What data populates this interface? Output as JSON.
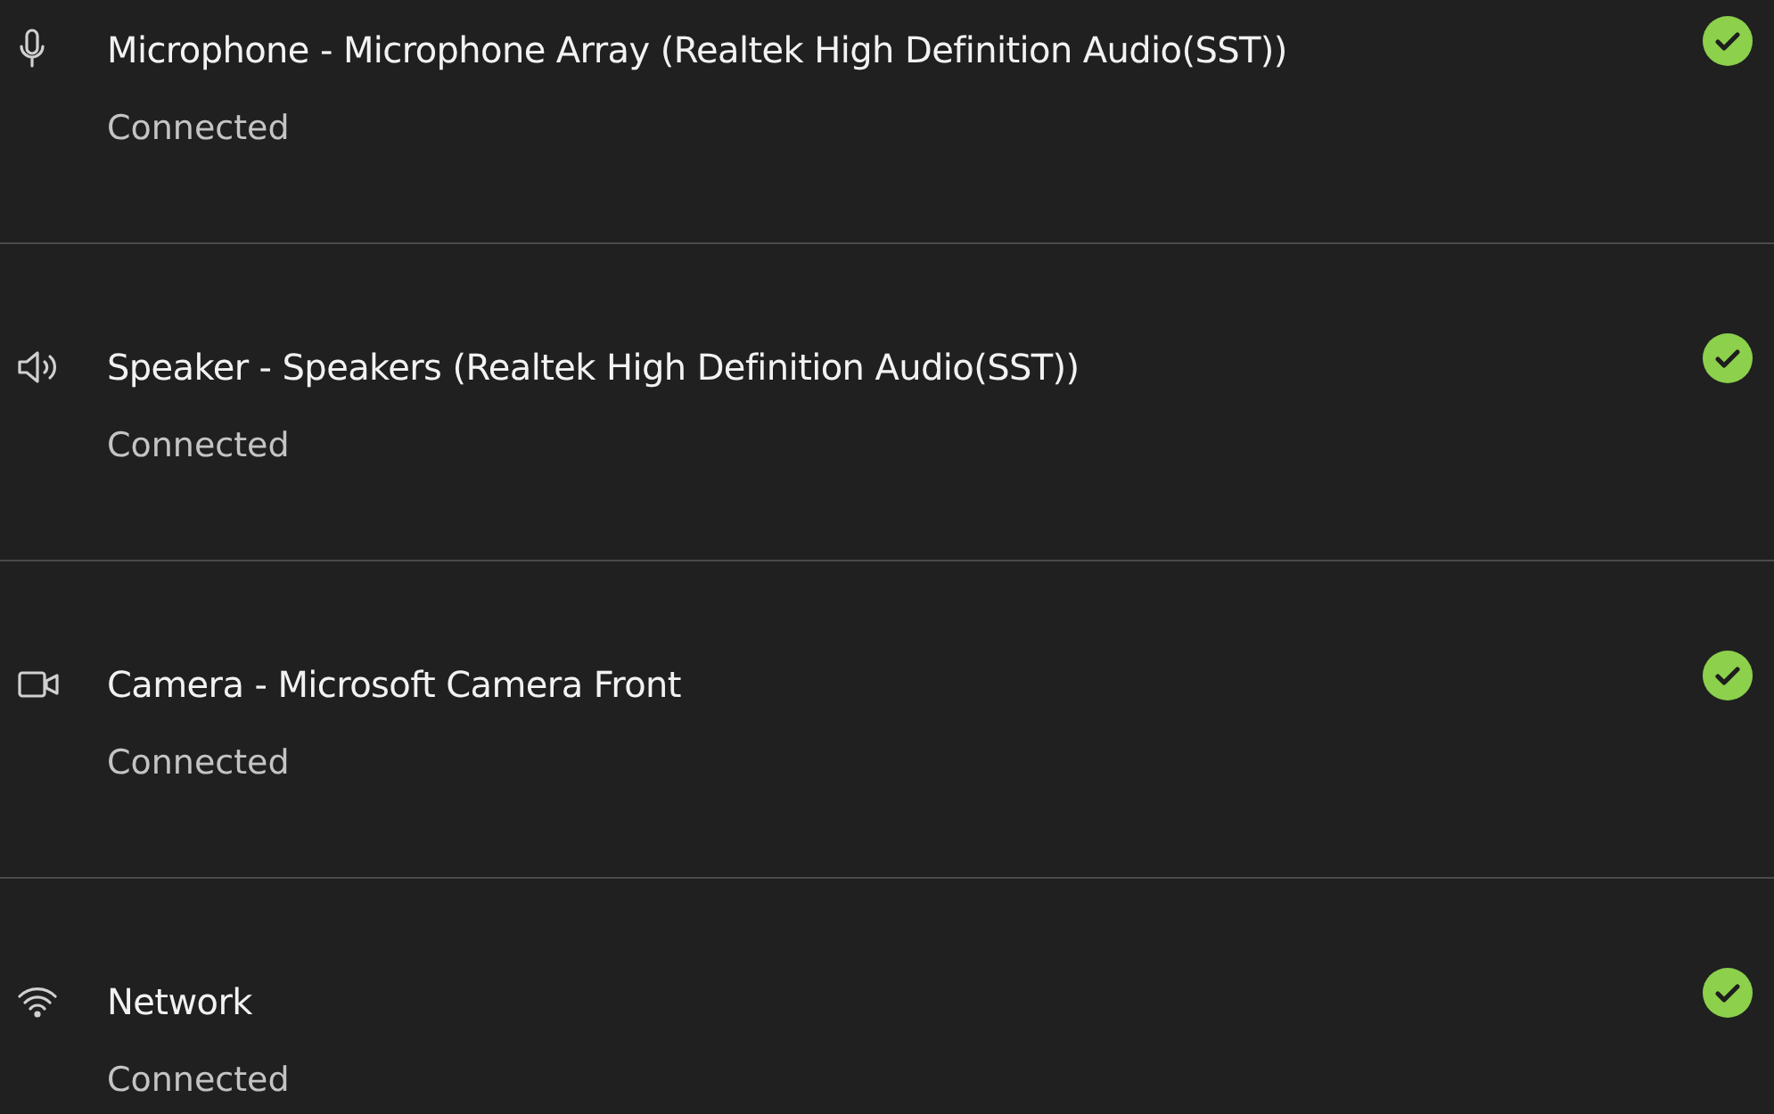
{
  "devices": [
    {
      "kind": "microphone",
      "name": "Microphone - Microphone Array (Realtek High Definition Audio(SST))",
      "status": "Connected",
      "ok": true
    },
    {
      "kind": "speaker",
      "name": "Speaker - Speakers (Realtek High Definition Audio(SST))",
      "status": "Connected",
      "ok": true
    },
    {
      "kind": "camera",
      "name": "Camera - Microsoft Camera Front",
      "status": "Connected",
      "ok": true
    },
    {
      "kind": "network",
      "name": "Network",
      "status": "Connected",
      "ok": true
    }
  ]
}
